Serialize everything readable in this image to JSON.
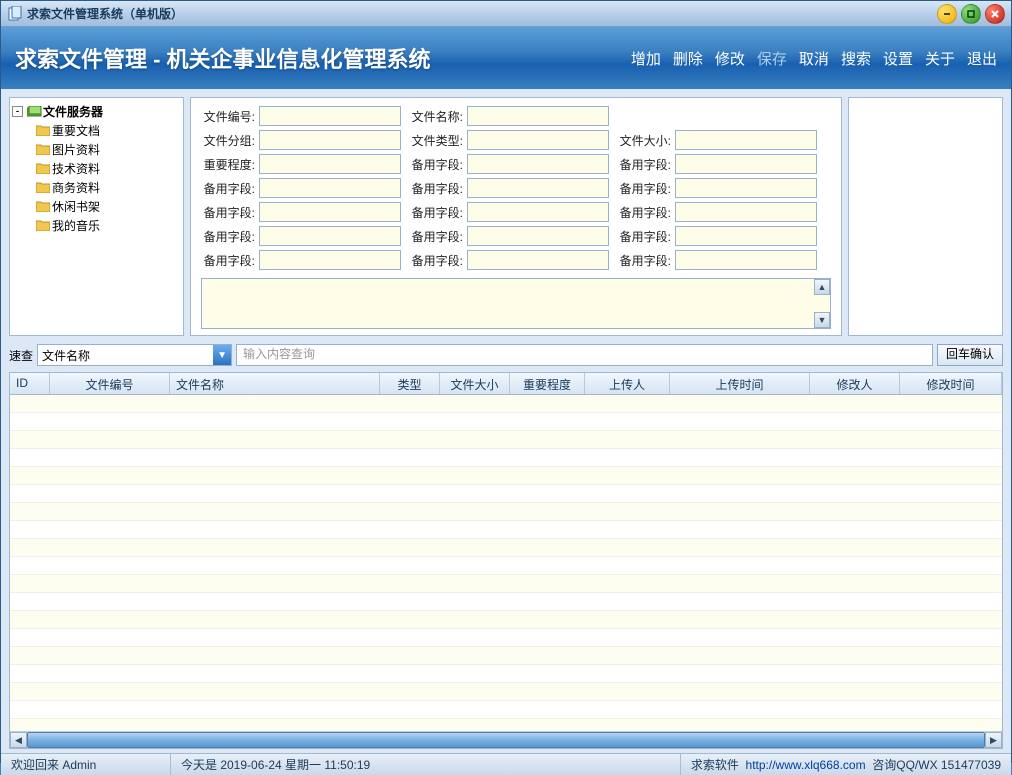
{
  "window": {
    "title": "求索文件管理系统（单机版）"
  },
  "banner": {
    "title": "求索文件管理 - 机关企事业信息化管理系统",
    "menu": {
      "add": "增加",
      "delete": "删除",
      "edit": "修改",
      "save": "保存",
      "cancel": "取消",
      "search": "搜索",
      "settings": "设置",
      "about": "关于",
      "exit": "退出"
    }
  },
  "tree": {
    "root": "文件服务器",
    "nodes": [
      "重要文档",
      "图片资料",
      "技术资料",
      "商务资料",
      "休闲书架",
      "我的音乐"
    ]
  },
  "form": {
    "labels": {
      "file_no": "文件编号:",
      "file_name": "文件名称:",
      "file_group": "文件分组:",
      "file_type": "文件类型:",
      "file_size": "文件大小:",
      "importance": "重要程度:",
      "spare": "备用字段:"
    }
  },
  "search": {
    "label": "速查",
    "combo_value": "文件名称",
    "placeholder": "输入内容查询",
    "enter_btn": "回车确认"
  },
  "table": {
    "columns": {
      "id": "ID",
      "file_no": "文件编号",
      "file_name": "文件名称",
      "type": "类型",
      "file_size": "文件大小",
      "importance": "重要程度",
      "uploader": "上传人",
      "upload_time": "上传时间",
      "modifier": "修改人",
      "modify_time": "修改时间"
    }
  },
  "status": {
    "welcome": "欢迎回来 Admin",
    "date": "今天是 2019-06-24 星期一 11:50:19",
    "company": "求索软件",
    "url": "http://www.xlq668.com",
    "contact": "咨询QQ/WX 151477039"
  }
}
